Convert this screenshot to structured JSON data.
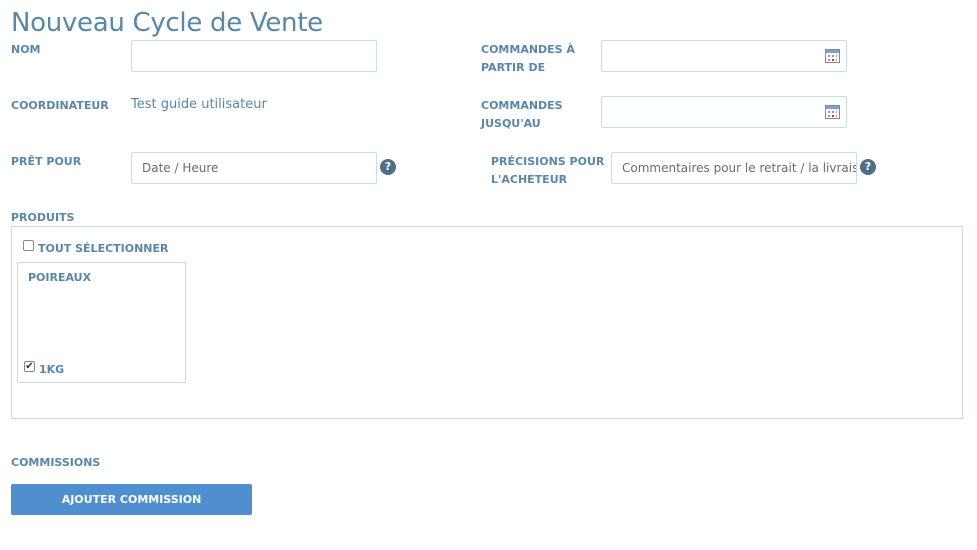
{
  "page": {
    "title": "Nouveau Cycle de Vente"
  },
  "form": {
    "nom": {
      "label": "NOM",
      "value": ""
    },
    "orders_from": {
      "label_line1": "COMMANDES À",
      "label_line2": "PARTIR DE",
      "value": ""
    },
    "coordinator": {
      "label": "COORDINATEUR",
      "value": "Test guide utilisateur"
    },
    "orders_until": {
      "label_line1": "COMMANDES",
      "label_line2": "JUSQU'AU",
      "value": ""
    },
    "ready_for": {
      "label": "PRÊT POUR",
      "placeholder": "Date / Heure",
      "help_icon": "question-circle-icon"
    },
    "buyer_details": {
      "label_line1": "PRÉCISIONS POUR",
      "label_line2": "L'ACHETEUR",
      "placeholder": "Commentaires pour le retrait / la livraison",
      "help_icon": "question-circle-icon"
    }
  },
  "products": {
    "label": "PRODUITS",
    "select_all_label": "TOUT SÉLECTIONNER",
    "select_all_checked": false,
    "items": [
      {
        "name": "POIREAUX",
        "variants": [
          {
            "label": "1KG",
            "checked": true
          }
        ]
      }
    ]
  },
  "commissions": {
    "label": "COMMISSIONS",
    "add_button_label": "AJOUTER COMMISSION COORDINATEUR"
  },
  "colors": {
    "label": "#5a86a8",
    "border": "#c6dce8",
    "button": "#4f8fd0",
    "help_icon": "#4f6f86"
  }
}
